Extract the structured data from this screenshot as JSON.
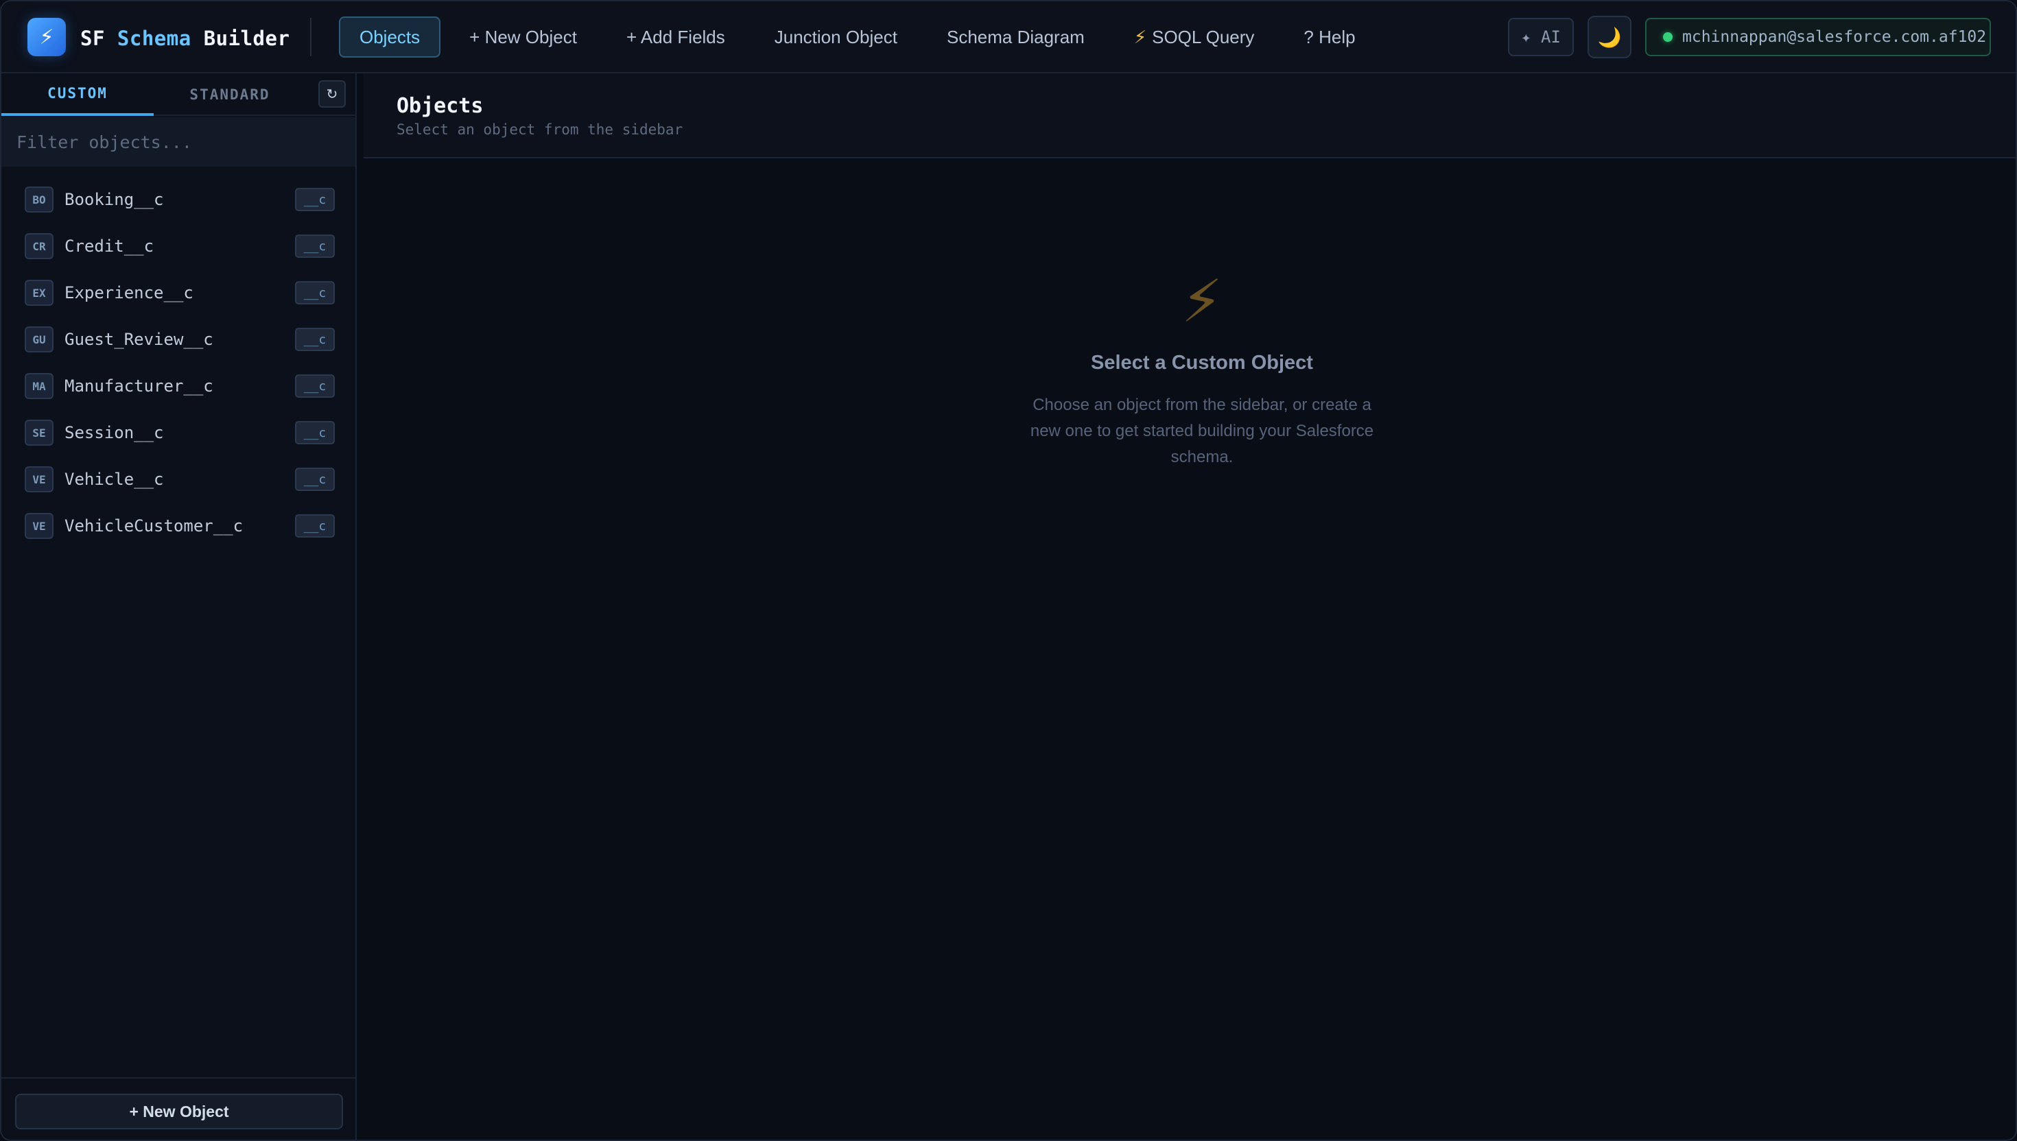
{
  "app": {
    "logo_glyph": "⚡",
    "brand_word1": "SF",
    "brand_word2": "Schema",
    "brand_word3": "Builder"
  },
  "nav": {
    "items": [
      {
        "label": "Objects",
        "active": true
      },
      {
        "label": "+ New Object"
      },
      {
        "label": "+ Add Fields"
      },
      {
        "label": "Junction Object"
      },
      {
        "label": "Schema Diagram"
      },
      {
        "label": "SOQL Query",
        "icon": "lightning-icon"
      },
      {
        "label": "? Help"
      }
    ]
  },
  "topright": {
    "ai_label": "✦ AI",
    "theme_icon": "moon-icon",
    "theme_glyph": "🌙",
    "user": "mchinnappan@salesforce.com.af102",
    "status_color": "#34d07a"
  },
  "sidebar": {
    "tabs": [
      {
        "label": "CUSTOM",
        "active": true
      },
      {
        "label": "STANDARD"
      }
    ],
    "refresh_glyph": "↻",
    "filter_placeholder": "Filter objects...",
    "objects": [
      {
        "abbr": "BO",
        "name": "Booking__c",
        "suffix": "__c"
      },
      {
        "abbr": "CR",
        "name": "Credit__c",
        "suffix": "__c"
      },
      {
        "abbr": "EX",
        "name": "Experience__c",
        "suffix": "__c"
      },
      {
        "abbr": "GU",
        "name": "Guest_Review__c",
        "suffix": "__c"
      },
      {
        "abbr": "MA",
        "name": "Manufacturer__c",
        "suffix": "__c"
      },
      {
        "abbr": "SE",
        "name": "Session__c",
        "suffix": "__c"
      },
      {
        "abbr": "VE",
        "name": "Vehicle__c",
        "suffix": "__c"
      },
      {
        "abbr": "VE",
        "name": "VehicleCustomer__c",
        "suffix": "__c"
      }
    ],
    "new_object_label": "+ New Object"
  },
  "main": {
    "title": "Objects",
    "subtitle": "Select an object from the sidebar",
    "empty": {
      "icon_glyph": "⚡",
      "title": "Select a Custom Object",
      "line1": "Choose an object from the sidebar, or create a",
      "line2": "new one to get started building your Salesforce",
      "line3": "schema."
    }
  },
  "colors": {
    "background": "#090d16",
    "accent": "#6cc4ff",
    "active_tab_border": "#3ea8ee",
    "brand_gradient_start": "#4da8ff",
    "brand_gradient_end": "#2266e0"
  }
}
